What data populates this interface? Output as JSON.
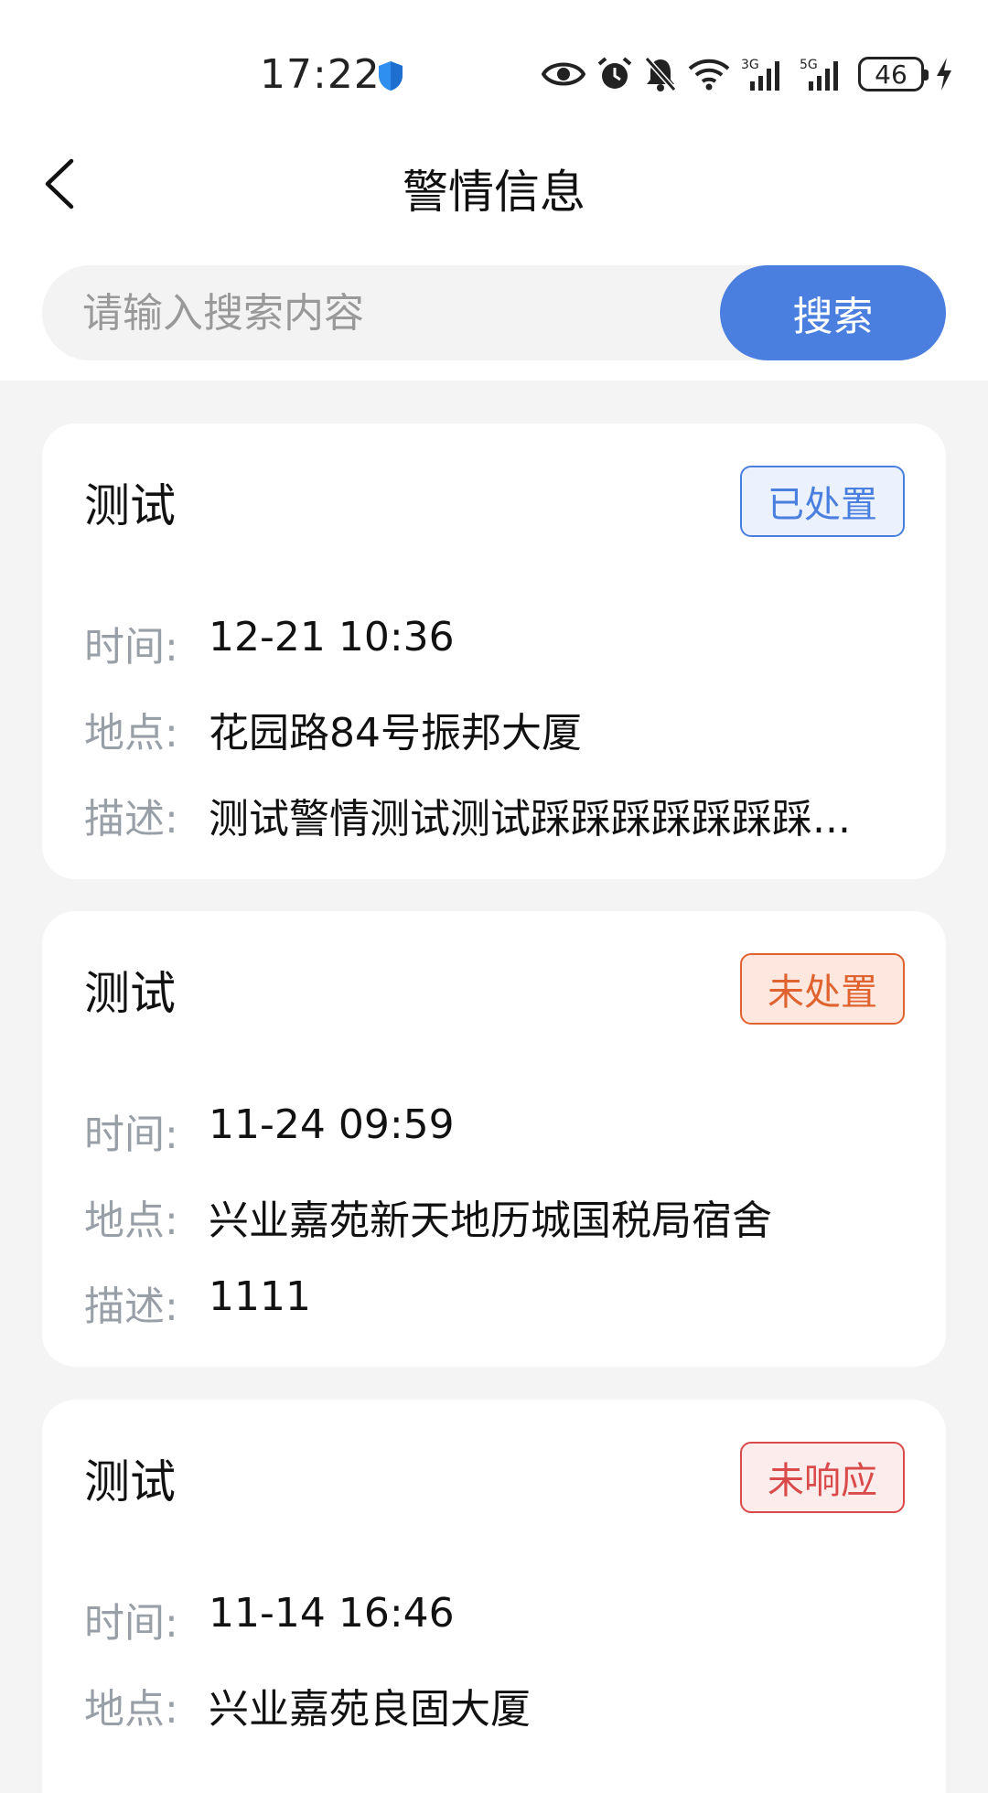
{
  "status_bar": {
    "time": "17:22",
    "battery": "46",
    "icons": [
      "shield-icon",
      "eye-icon",
      "alarm-icon",
      "bell-off-icon",
      "wifi-icon",
      "signal-3g-icon",
      "signal-5g-icon",
      "battery-icon",
      "charging-icon"
    ]
  },
  "header": {
    "title": "警情信息",
    "back_icon": "chevron-left-icon"
  },
  "search": {
    "placeholder": "请输入搜索内容",
    "value": "",
    "button_label": "搜索"
  },
  "labels": {
    "time": "时间:",
    "location": "地点:",
    "description": "描述:"
  },
  "alerts": [
    {
      "title": "测试",
      "status": "已处置",
      "status_color": "#4a7fe0",
      "time": "12-21 10:36",
      "location": "花园路84号振邦大厦",
      "description": "测试警情测试测试踩踩踩踩踩踩踩..."
    },
    {
      "title": "测试",
      "status": "未处置",
      "status_color": "#e0622e",
      "time": "11-24 09:59",
      "location": "兴业嘉苑新天地历城国税局宿舍",
      "description": "1111"
    },
    {
      "title": "测试",
      "status": "未响应",
      "status_color": "#d94a4a",
      "time": "11-14 16:46",
      "location": "兴业嘉苑良固大厦"
    }
  ],
  "colors": {
    "accent": "#4a7fe0",
    "background": "#f4f4f4"
  }
}
